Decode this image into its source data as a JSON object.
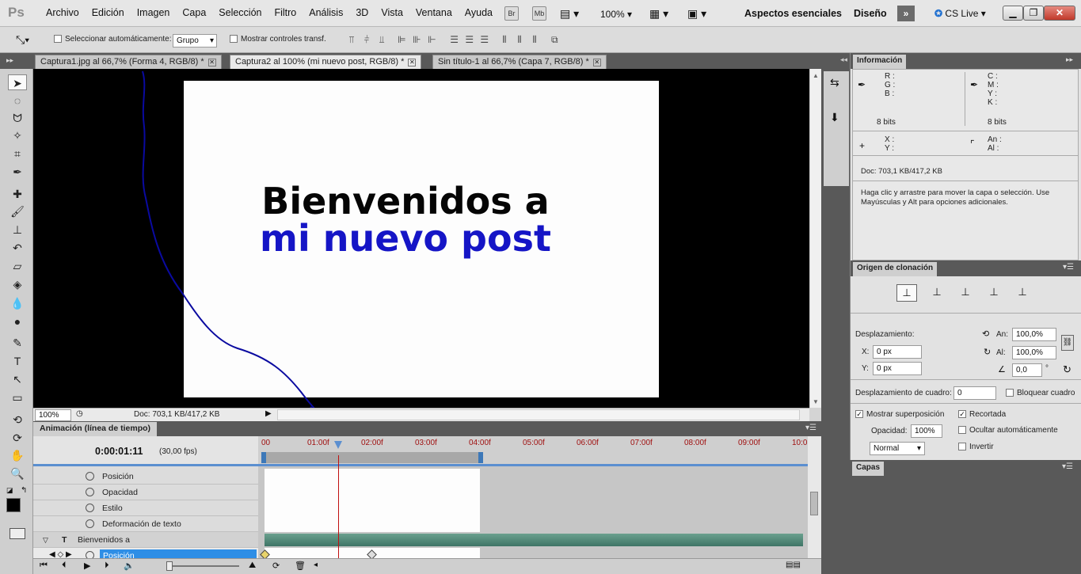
{
  "app": {
    "logo": "Ps",
    "menu": [
      "Archivo",
      "Edición",
      "Imagen",
      "Capa",
      "Selección",
      "Filtro",
      "Análisis",
      "3D",
      "Vista",
      "Ventana",
      "Ayuda"
    ],
    "bridge_btn": "Br",
    "minibridge_btn": "Mb",
    "zoom_level": "100%",
    "workspaces": [
      "Aspectos esenciales",
      "Diseño"
    ],
    "expand_label": "»",
    "cs_live": "CS Live"
  },
  "options_bar": {
    "auto_select_label": "Seleccionar automáticamente:",
    "auto_select_value": "Grupo",
    "transform_label": "Mostrar controles transf."
  },
  "document_tabs": [
    {
      "label": "Captura1.jpg al 66,7% (Forma 4, RGB/8) *",
      "active": false
    },
    {
      "label": "Captura2 al 100% (mi nuevo post, RGB/8) *",
      "active": true
    },
    {
      "label": "Sin título-1 al 66,7% (Capa 7, RGB/8) *",
      "active": false
    }
  ],
  "canvas": {
    "line1": "Bienvenidos a",
    "line2": "mi nuevo post",
    "line1_color": "#050505",
    "line2_color": "#1515c6",
    "annotation_color": "#0a0aa0"
  },
  "status": {
    "zoom": "100%",
    "doc": "Doc: 703,1 KB/417,2 KB"
  },
  "timeline": {
    "title": "Animación (línea de tiempo)",
    "current_time": "0:00:01:11",
    "fps": "(30,00 fps)",
    "ruler": [
      "00",
      "01:00f",
      "02:00f",
      "03:00f",
      "04:00f",
      "05:00f",
      "06:00f",
      "07:00f",
      "08:00f",
      "09:00f",
      "10:0"
    ],
    "properties": [
      "Posición",
      "Opacidad",
      "Estilo",
      "Deformación de texto"
    ],
    "layer_name": "Bienvenidos a",
    "selected_property": "Posición"
  },
  "info_panel": {
    "title": "Información",
    "rgb": [
      "R :",
      "G :",
      "B :"
    ],
    "cmyk": [
      "C :",
      "M :",
      "Y :",
      "K :"
    ],
    "bits_left": "8 bits",
    "bits_right": "8 bits",
    "xy": [
      "X :",
      "Y :"
    ],
    "wh": [
      "An :",
      "Al :"
    ],
    "doc": "Doc: 703,1 KB/417,2 KB",
    "hint": "Haga clic y arrastre para mover la capa o selección. Use Mayúsculas y Alt para opciones adicionales."
  },
  "clone_panel": {
    "title": "Origen de clonación",
    "offset_label": "Desplazamiento:",
    "x_label": "X:",
    "x_value": "0 px",
    "y_label": "Y:",
    "y_value": "0 px",
    "w_label": "An:",
    "w_value": "100,0%",
    "h_label": "Al:",
    "h_value": "100,0%",
    "angle_value": "0,0",
    "angle_unit": "°",
    "frame_offset_label": "Desplazamiento de cuadro:",
    "frame_offset_value": "0",
    "lock_frame": "Bloquear cuadro",
    "show_overlay": "Mostrar superposición",
    "clipped": "Recortada",
    "opacity_label": "Opacidad:",
    "opacity_value": "100%",
    "autohide": "Ocultar automáticamente",
    "blend_mode": "Normal",
    "invert": "Invertir"
  },
  "layers_panel": {
    "title": "Capas"
  }
}
